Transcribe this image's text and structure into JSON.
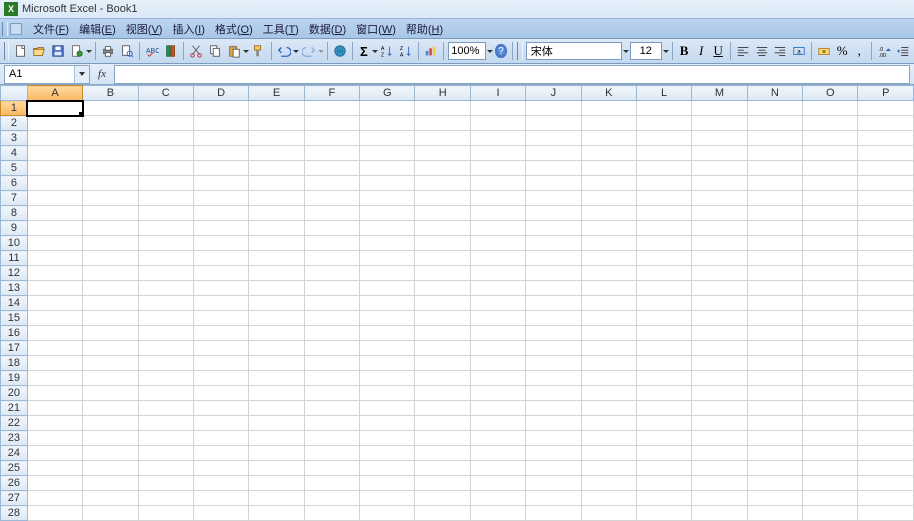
{
  "title": "Microsoft Excel - Book1",
  "menus": {
    "file": {
      "label": "文件",
      "hotkey": "F"
    },
    "edit": {
      "label": "编辑",
      "hotkey": "E"
    },
    "view": {
      "label": "视图",
      "hotkey": "V"
    },
    "insert": {
      "label": "插入",
      "hotkey": "I"
    },
    "format": {
      "label": "格式",
      "hotkey": "O"
    },
    "tools": {
      "label": "工具",
      "hotkey": "T"
    },
    "data": {
      "label": "数据",
      "hotkey": "D"
    },
    "window": {
      "label": "窗口",
      "hotkey": "W"
    },
    "help": {
      "label": "帮助",
      "hotkey": "H"
    }
  },
  "toolbar": {
    "zoom": "100%",
    "font_name": "宋体",
    "font_size": "12",
    "currency_symbol": "%",
    "comma": ","
  },
  "namebox": {
    "value": "A1"
  },
  "formula": {
    "fx": "fx"
  },
  "grid": {
    "columns": [
      "A",
      "B",
      "C",
      "D",
      "E",
      "F",
      "G",
      "H",
      "I",
      "J",
      "K",
      "L",
      "M",
      "N",
      "O",
      "P"
    ],
    "row_count": 28,
    "active_row": 1,
    "active_col": "A"
  }
}
